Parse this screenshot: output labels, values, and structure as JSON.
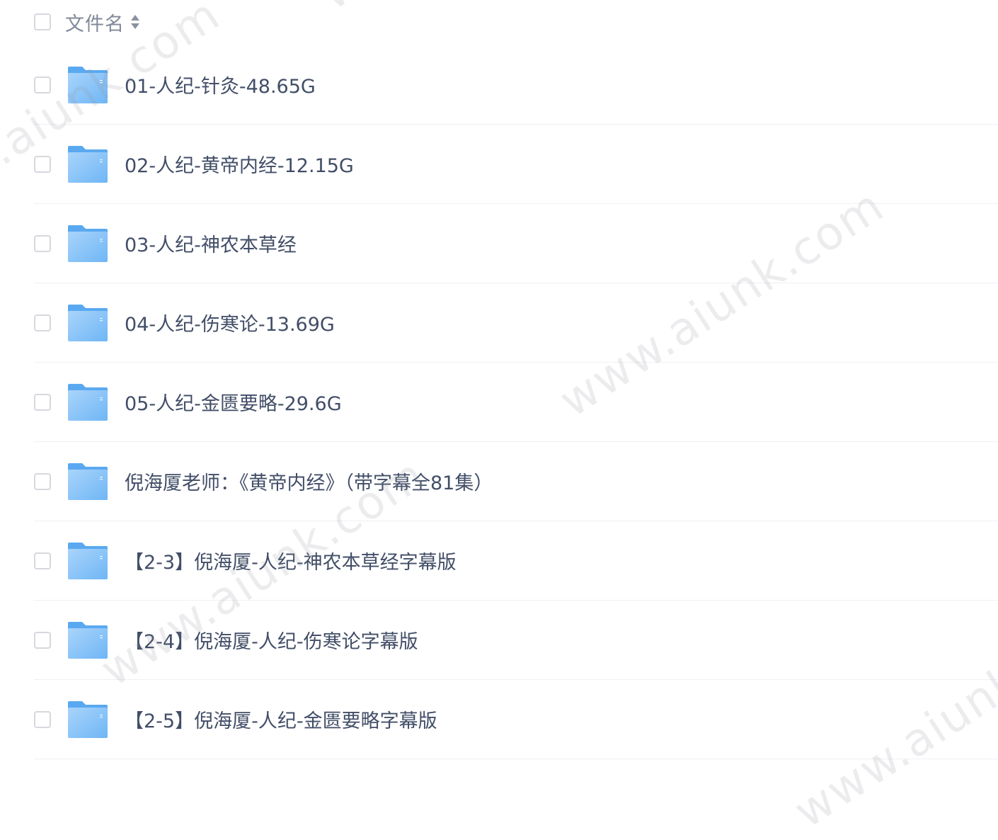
{
  "header": {
    "column_label": "文件名",
    "sort_icon": "sort-icon"
  },
  "files": [
    {
      "name": "01-人纪-针灸-48.65G",
      "icon": "folder-icon"
    },
    {
      "name": "02-人纪-黄帝内经-12.15G",
      "icon": "folder-icon"
    },
    {
      "name": "03-人纪-神农本草经",
      "icon": "folder-icon"
    },
    {
      "name": "04-人纪-伤寒论-13.69G",
      "icon": "folder-icon"
    },
    {
      "name": "05-人纪-金匮要略-29.6G",
      "icon": "folder-icon"
    },
    {
      "name": "倪海厦老师：《黄帝内经》（带字幕全81集）",
      "icon": "folder-icon"
    },
    {
      "name": "【2-3】倪海厦-人纪-神农本草经字幕版",
      "icon": "folder-icon"
    },
    {
      "name": "【2-4】倪海厦-人纪-伤寒论字幕版",
      "icon": "folder-icon"
    },
    {
      "name": "【2-5】倪海厦-人纪-金匮要略字幕版",
      "icon": "folder-icon"
    }
  ],
  "watermark": {
    "text": "www.aiunk.com"
  },
  "colors": {
    "folder_light": "#a9d4fb",
    "folder_dark": "#5aa9f0",
    "text": "#424e67",
    "header_text": "#818999",
    "divider": "#eef0f4"
  }
}
